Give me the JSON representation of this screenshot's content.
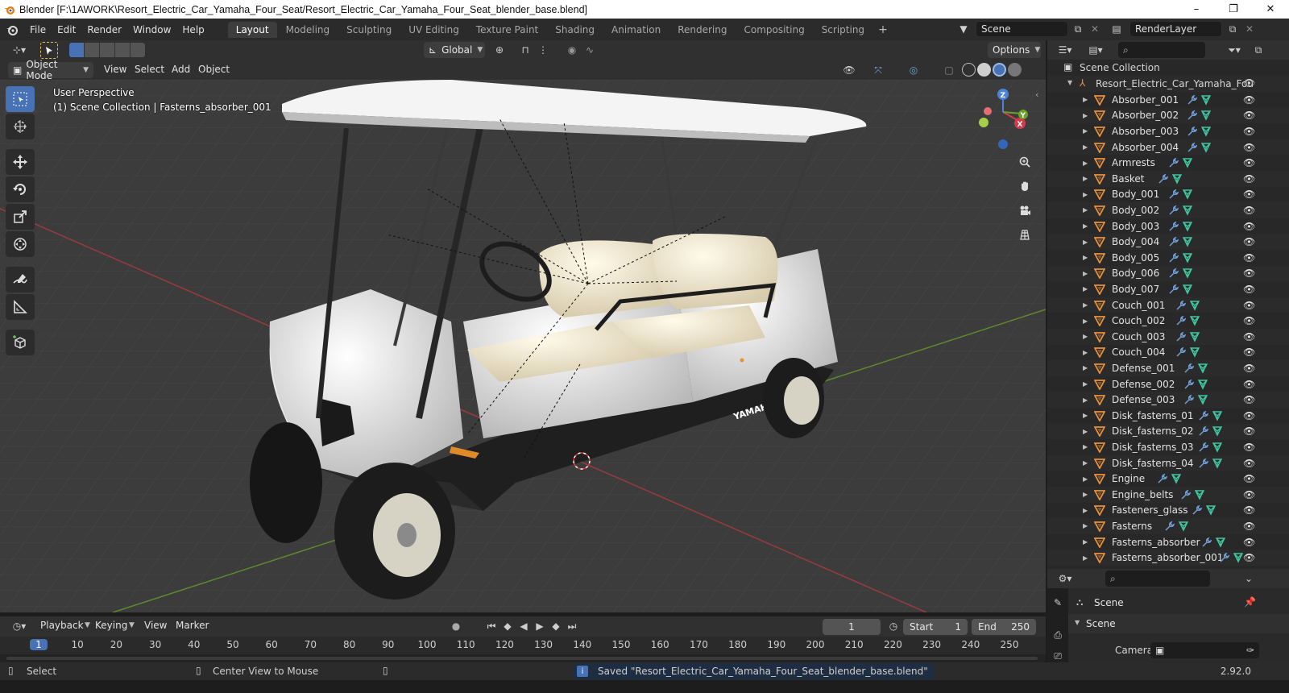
{
  "titlebar": {
    "title": "Blender [F:\\1AWORK\\Resort_Electric_Car_Yamaha_Four_Seat/Resort_Electric_Car_Yamaha_Four_Seat_blender_base.blend]",
    "minimize": "–",
    "maximize": "❐",
    "close": "✕"
  },
  "menu": [
    "File",
    "Edit",
    "Render",
    "Window",
    "Help"
  ],
  "workspaces": [
    {
      "label": "Layout",
      "active": true
    },
    {
      "label": "Modeling"
    },
    {
      "label": "Sculpting"
    },
    {
      "label": "UV Editing"
    },
    {
      "label": "Texture Paint"
    },
    {
      "label": "Shading"
    },
    {
      "label": "Animation"
    },
    {
      "label": "Rendering"
    },
    {
      "label": "Compositing"
    },
    {
      "label": "Scripting"
    }
  ],
  "add_workspace": "+",
  "scene_field": "Scene",
  "renderlayer_field": "RenderLayer",
  "viewport_header": {
    "transform_orientation": "Global",
    "options": "Options"
  },
  "viewport_toolrow": {
    "mode": "Object Mode",
    "menus": [
      "View",
      "Select",
      "Add",
      "Object"
    ]
  },
  "viewport": {
    "perspective": "User Perspective",
    "collection_info": "(1) Scene Collection | Fasterns_absorber_001",
    "model_badge": "YAMAHA",
    "axes": {
      "x": "X",
      "y": "Y",
      "z": "Z"
    }
  },
  "timeline": {
    "menus": [
      "Playback",
      "Keying",
      "View",
      "Marker"
    ],
    "current_frame": "1",
    "start_label": "Start",
    "start_value": "1",
    "end_label": "End",
    "end_value": "250",
    "frames": [
      "1",
      "10",
      "20",
      "30",
      "40",
      "50",
      "60",
      "70",
      "80",
      "90",
      "100",
      "110",
      "120",
      "130",
      "140",
      "150",
      "160",
      "170",
      "180",
      "190",
      "200",
      "210",
      "220",
      "230",
      "240",
      "250"
    ]
  },
  "statusbar": {
    "select": "Select",
    "center_view": "Center View to Mouse",
    "message": "Saved \"Resort_Electric_Car_Yamaha_Four_Seat_blender_base.blend\"",
    "version": "2.92.0"
  },
  "outliner": {
    "scene_collection": "Scene Collection",
    "root": "Resort_Electric_Car_Yamaha_Fou",
    "items": [
      "Absorber_001",
      "Absorber_002",
      "Absorber_003",
      "Absorber_004",
      "Armrests",
      "Basket",
      "Body_001",
      "Body_002",
      "Body_003",
      "Body_004",
      "Body_005",
      "Body_006",
      "Body_007",
      "Couch_001",
      "Couch_002",
      "Couch_003",
      "Couch_004",
      "Defense_001",
      "Defense_002",
      "Defense_003",
      "Disk_fasterns_01",
      "Disk_fasterns_02",
      "Disk_fasterns_03",
      "Disk_fasterns_04",
      "Engine",
      "Engine_belts",
      "Fasteners_glass",
      "Fasterns",
      "Fasterns_absorber",
      "Fasterns_absorber_001"
    ]
  },
  "properties": {
    "scene_title": "Scene",
    "panel_title": "Scene",
    "camera_label": "Camera"
  },
  "colors": {
    "accent": "#4772b3",
    "object_icon": "#e8913a",
    "modifier_icon": "#6f9fd8",
    "mesh_icon": "#3fc5a0"
  }
}
